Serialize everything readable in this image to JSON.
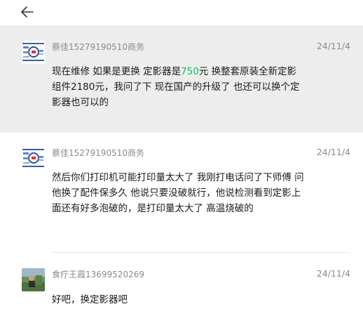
{
  "messages": [
    {
      "sender": "蔡佳15279190510商务",
      "time": "24/11/4",
      "text_before": "现在维修 如果是更换 定影器是",
      "text_highlight": "750",
      "text_after": "元  换整套原装全新定影组件2180元，我问了下 现在国产的升级了 也还可以换个定影器也可以的",
      "highlight_color": "#07c160"
    },
    {
      "sender": "蔡佳15279190510商务",
      "time": "24/11/4",
      "text": "然后你们打印机可能打印量太大了 我刚打电话问了下师傅 问他换了配件保多久  他说只要没破就行，他说检测看到定影上面还有好多泡破的，是打印量太大了 高温烧破的"
    },
    {
      "sender": "食疗王霞13699520269",
      "time": "24/11/4",
      "text": "好吧，换定影器吧"
    }
  ]
}
